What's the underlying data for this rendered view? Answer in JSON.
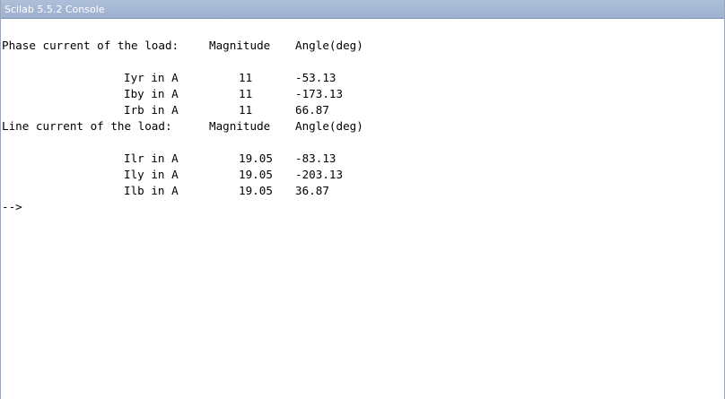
{
  "window": {
    "title": "Scilab 5.5.2 Console"
  },
  "console": {
    "phase_header": {
      "label": "Phase current of the load:",
      "magnitude_header": "Magnitude",
      "angle_header": "Angle(deg)"
    },
    "phase_rows": [
      {
        "name": "Iyr in A",
        "magnitude": "11",
        "angle": "-53.13"
      },
      {
        "name": "Iby in A",
        "magnitude": "11",
        "angle": "-173.13"
      },
      {
        "name": "Irb in A",
        "magnitude": "11",
        "angle": "66.87"
      }
    ],
    "line_header": {
      "label": "Line current of the load:",
      "magnitude_header": "Magnitude",
      "angle_header": "Angle(deg)"
    },
    "line_rows": [
      {
        "name": "Ilr in A",
        "magnitude": "19.05",
        "angle": "-83.13"
      },
      {
        "name": "Ily in A",
        "magnitude": "19.05",
        "angle": "-203.13"
      },
      {
        "name": "Ilb in A",
        "magnitude": "19.05",
        "angle": "36.87"
      }
    ],
    "prompt": "-->"
  }
}
